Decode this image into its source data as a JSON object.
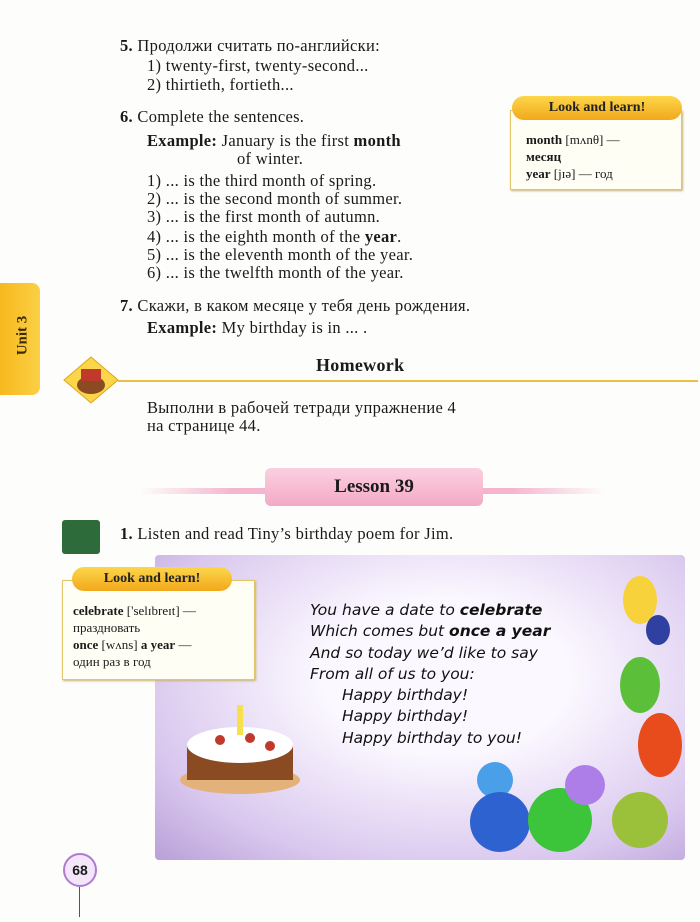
{
  "ex5": {
    "num": "5.",
    "title": "Продолжи считать по-английски:",
    "items": [
      "1) twenty-first, twenty-second...",
      "2) thirtieth, fortieth..."
    ]
  },
  "ex6": {
    "num": "6.",
    "title": "Complete the sentences.",
    "example_label": "Example:",
    "example_a": "January is the first",
    "example_bold": "month",
    "example_b": "of winter.",
    "items": [
      {
        "text": "1) ... is the third month of spring.",
        "bold": ""
      },
      {
        "text": "2) ... is the second month of summer.",
        "bold": ""
      },
      {
        "text": "3) ... is the first month of autumn.",
        "bold": ""
      },
      {
        "text": "4) ... is the eighth month of the",
        "bold": "year",
        "end": "."
      },
      {
        "text": "5) ... is the eleventh month of the year.",
        "bold": ""
      },
      {
        "text": "6) ... is the twelfth month of the year.",
        "bold": ""
      }
    ]
  },
  "look1": {
    "title": "Look and learn!",
    "w1": "month",
    "t1": "[mʌnθ] —",
    "r1": "месяц",
    "w2": "year",
    "t2": "[jɪə] — год"
  },
  "unit_tab": "Unit 3",
  "ex7": {
    "num": "7.",
    "title": "Скажи, в каком месяце у тебя день рождения.",
    "example_label": "Example:",
    "example": "My birthday is in ... ."
  },
  "homework": {
    "title": "Homework",
    "line1": "Выполни в рабочей тетради упражнение 4",
    "line2": "на странице 44."
  },
  "lesson": {
    "title": "Lesson 39"
  },
  "ex1": {
    "num": "1.",
    "title": "Listen and read Tiny’s birthday poem for Jim."
  },
  "look2": {
    "title": "Look and learn!",
    "w1": "celebrate",
    "t1": "['selɪbreɪt] —",
    "r1": "праздновать",
    "w2": "once",
    "t2": "[wʌns]",
    "w2b": "a year",
    "t2b": "—",
    "r2": "один раз в год"
  },
  "poem": {
    "l1a": "You have a date to ",
    "l1b": "celebrate",
    "l2a": "Which comes but ",
    "l2b": "once a year",
    "l3": "And so today we’d like to say",
    "l4": "From all of us to you:",
    "l5": "Happy birthday!",
    "l6": "Happy birthday!",
    "l7": "Happy birthday to you!"
  },
  "page_number": "68",
  "colors": {
    "tab": "#f7b81e",
    "lesson_banner": "#f7b8d0",
    "poem_bg": "#d9c7ee"
  }
}
